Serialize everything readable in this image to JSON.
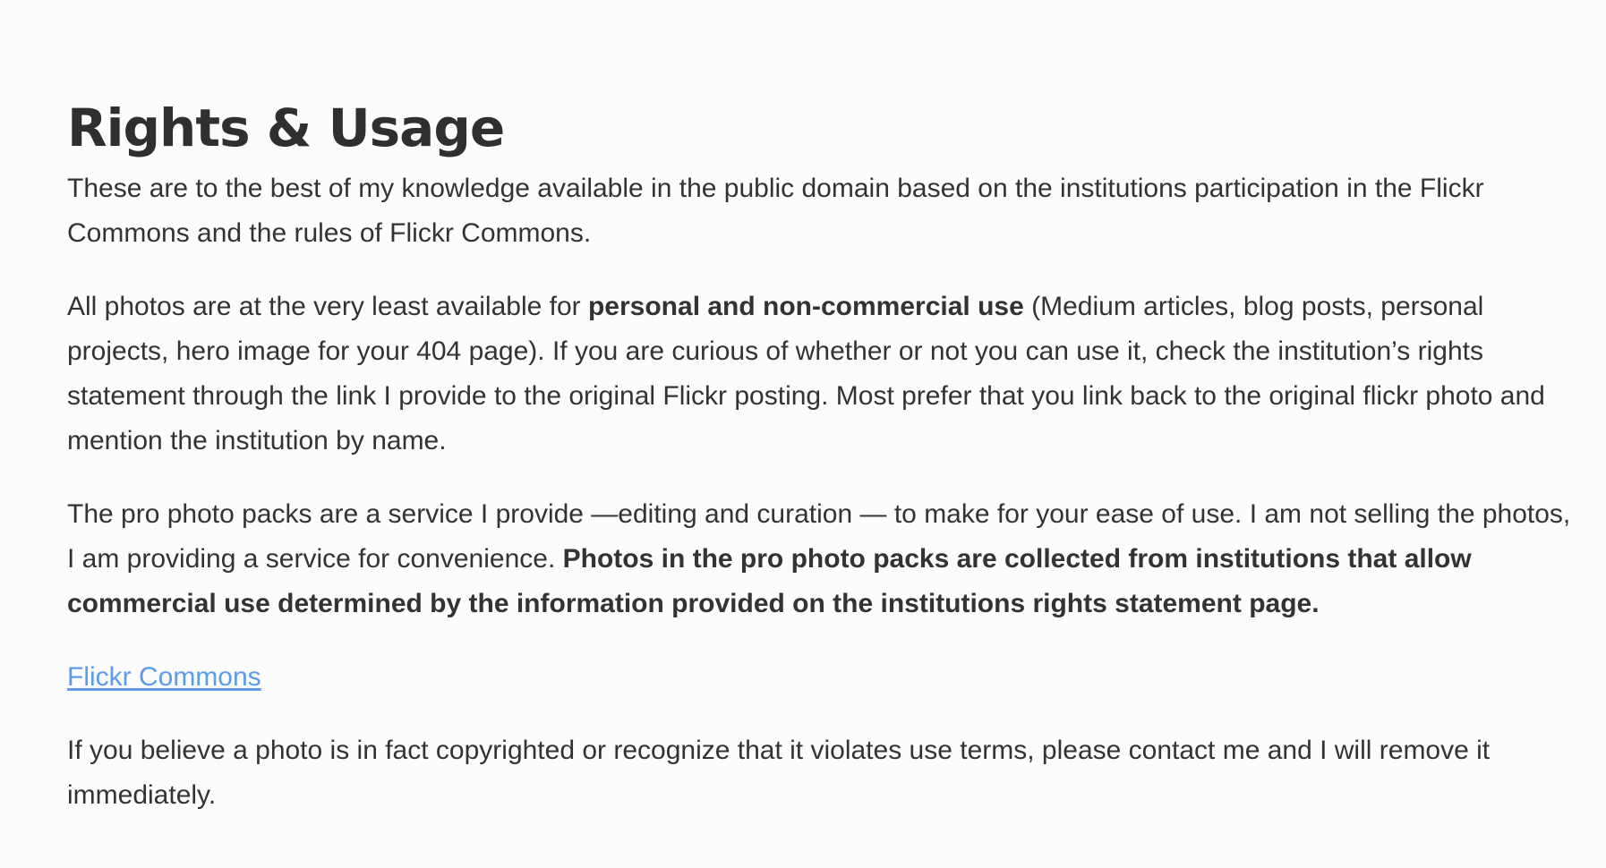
{
  "page": {
    "title": "Rights & Usage",
    "p1": "These are to the best of my knowledge available in the public domain based on the institutions participation in the Flickr Commons and the rules of Flickr Commons.",
    "p2_start": "All photos are at the very least available for ",
    "p2_bold": "personal and non-commercial use",
    "p2_rest": " (Medium articles, blog posts, personal projects, hero image for your 404 page). If you are curious of whether or not you can use it, check the institution’s rights statement through the link I provide to the original Flickr posting. Most prefer that you link back to the original flickr photo and mention the institution by name.",
    "p3_start": "The pro photo packs are a service I provide —editing and curation — to make for your ease of use. I am not selling the photos, I am providing a service for convenience. ",
    "p3_bold": "Photos in the pro photo packs are collected from institutions that allow commercial use determined by the information provided on the institutions rights statement page.",
    "link_label": "Flickr Commons",
    "p4": "If you believe a photo is in fact copyrighted or recognize that it violates use terms, please contact me and I will remove it immediately."
  },
  "colors": {
    "text": "#333333",
    "link": "#5b9be8",
    "background": "#fcfcfc"
  }
}
